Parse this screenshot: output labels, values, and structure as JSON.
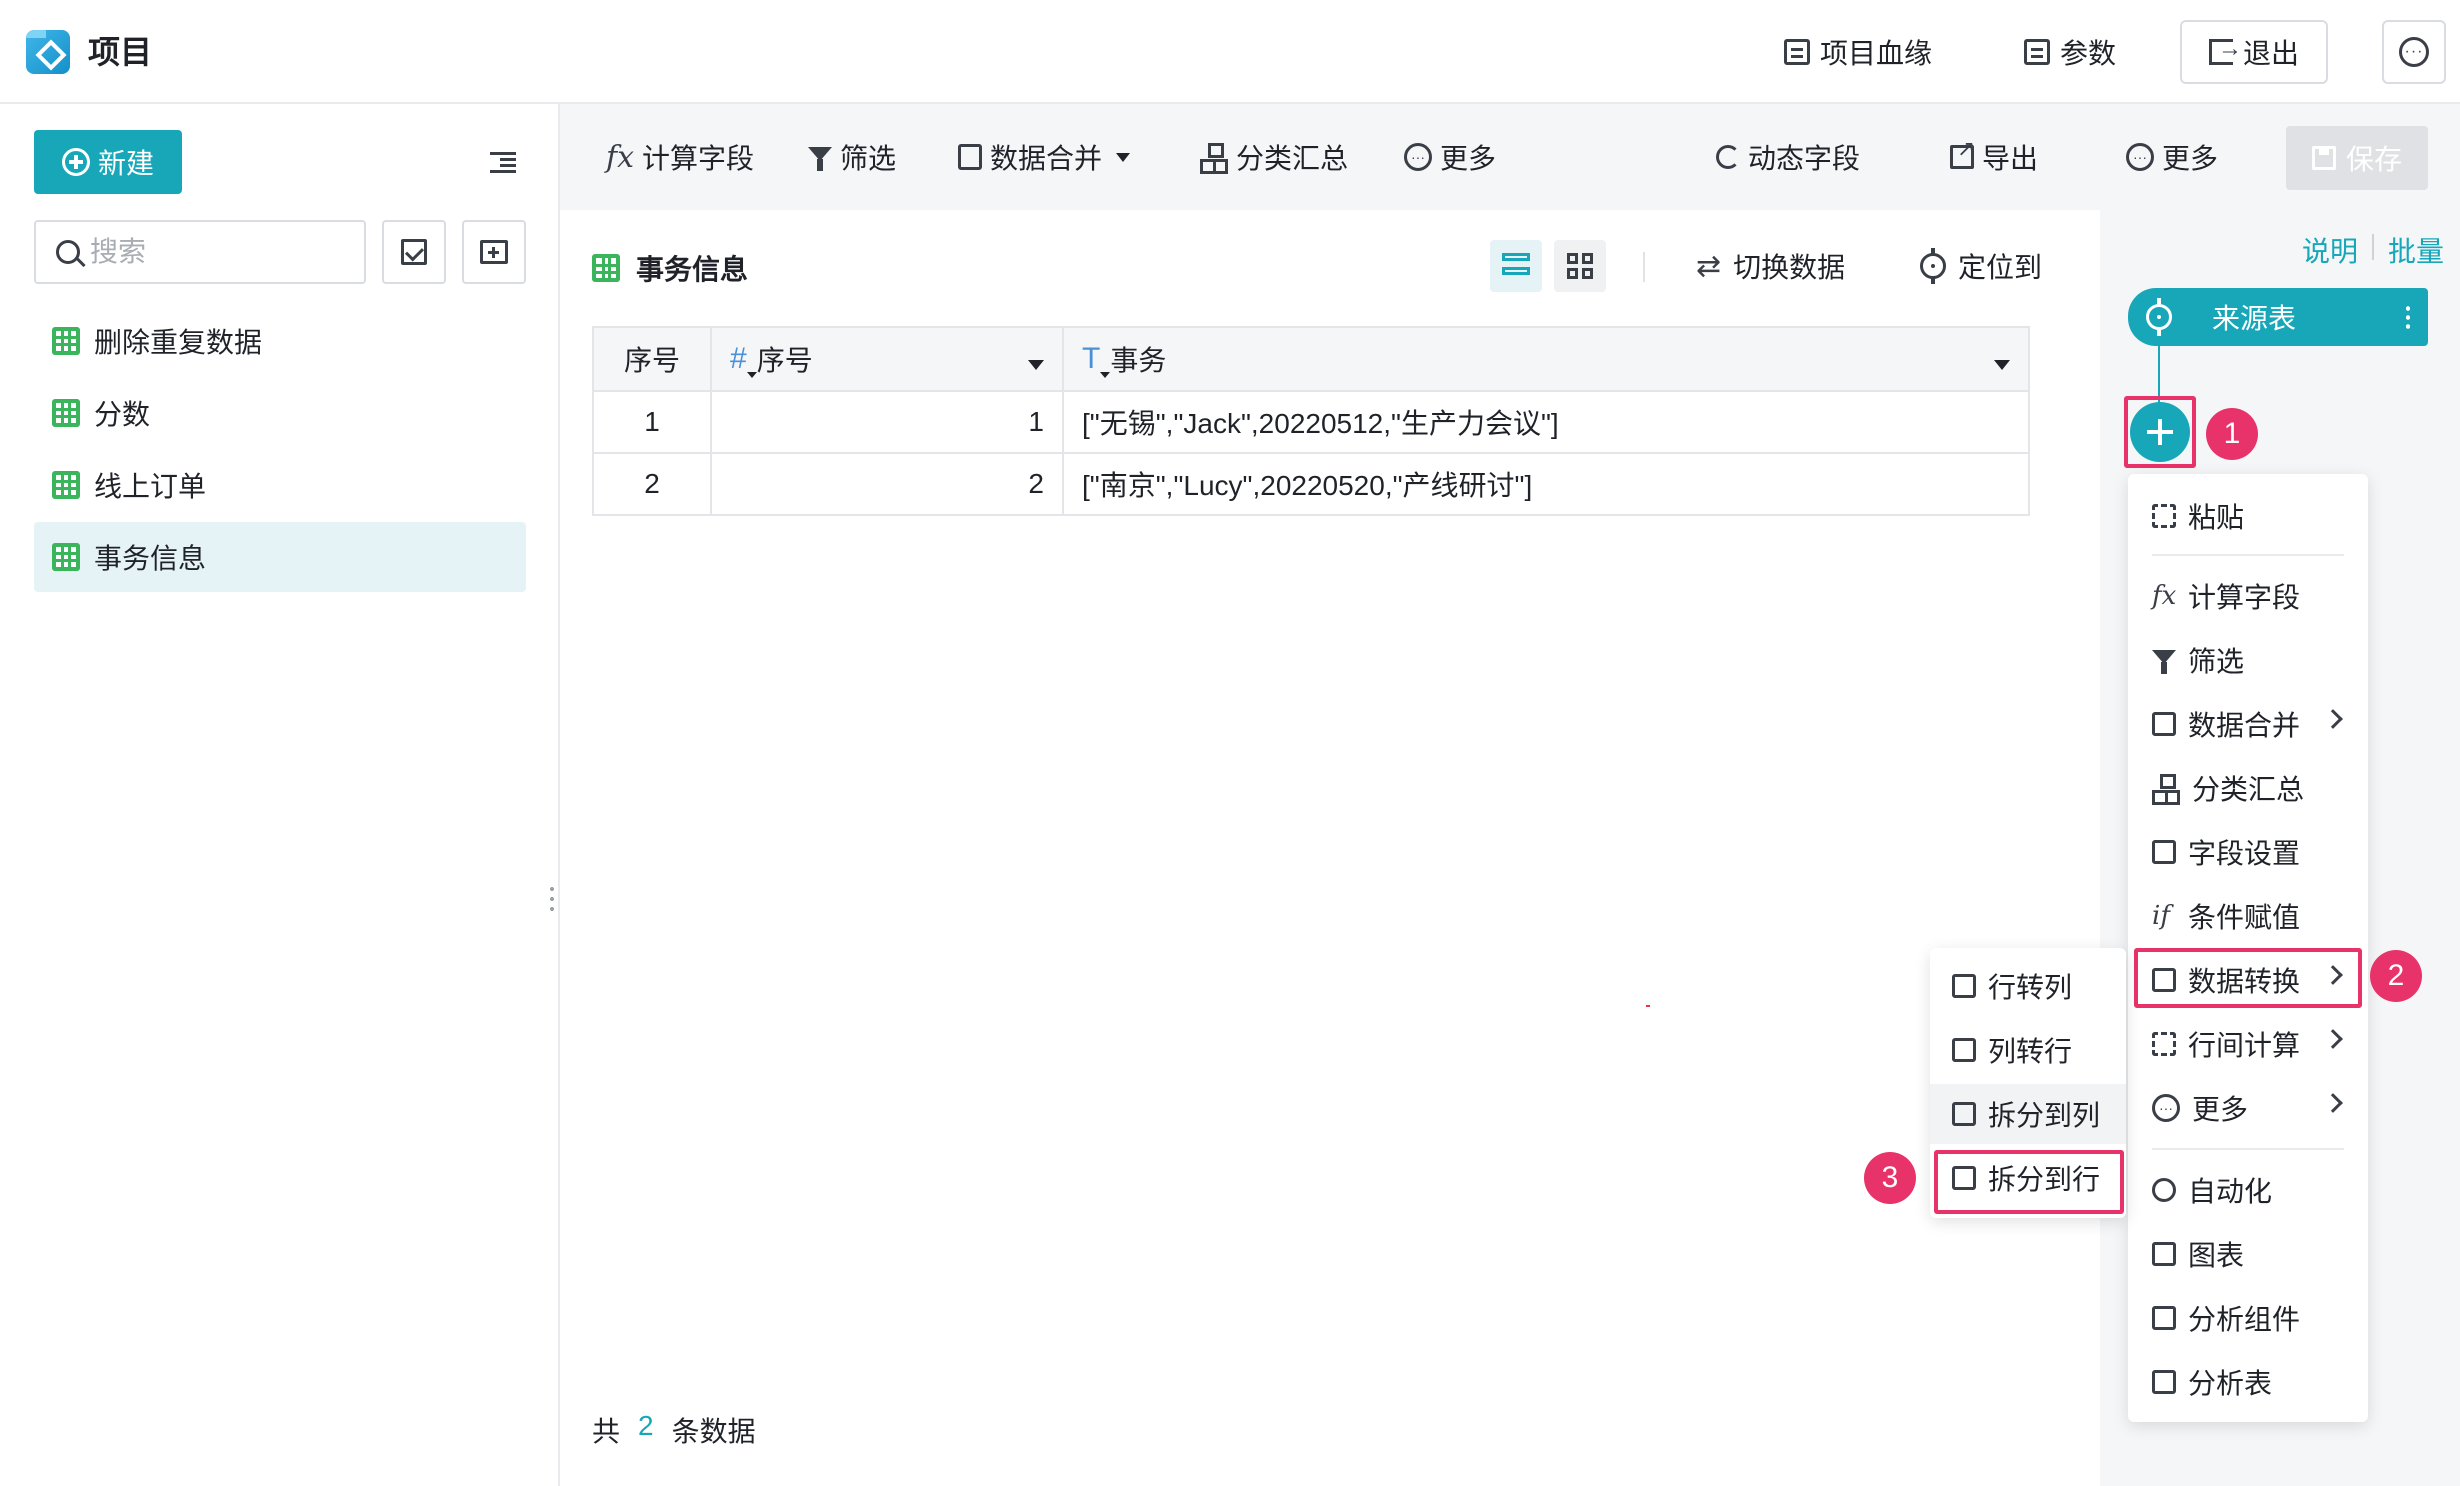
{
  "header": {
    "title": "项目",
    "lineage_label": "项目血缘",
    "params_label": "参数",
    "exit_label": "退出"
  },
  "sidebar": {
    "new_label": "新建",
    "search_placeholder": "搜索",
    "items": [
      {
        "label": "删除重复数据"
      },
      {
        "label": "分数"
      },
      {
        "label": "线上订单"
      },
      {
        "label": "事务信息"
      }
    ],
    "active_item": "事务信息"
  },
  "toolbar": {
    "calc_field": "计算字段",
    "filter": "筛选",
    "merge": "数据合并",
    "group_sum": "分类汇总",
    "more_left": "更多",
    "dynamic_field": "动态字段",
    "export": "导出",
    "more_right": "更多",
    "save": "保存"
  },
  "main": {
    "title": "事务信息",
    "switch_data": "切换数据",
    "locate": "定位到",
    "table": {
      "columns": [
        {
          "label": "序号",
          "type_icon": ""
        },
        {
          "label": "序号",
          "type_icon": "#"
        },
        {
          "label": "事务",
          "type_icon": "T"
        }
      ],
      "rows": [
        {
          "idx": "1",
          "num": "1",
          "text": "[\"无锡\",\"Jack\",20220512,\"生产力会议\"]"
        },
        {
          "idx": "2",
          "num": "2",
          "text": "[\"南京\",\"Lucy\",20220520,\"产线研讨\"]"
        }
      ]
    },
    "footer": {
      "prefix": "共",
      "count": "2",
      "suffix": "条数据"
    }
  },
  "flow": {
    "help_link": "说明",
    "batch_link": "批量",
    "source_node": "来源表"
  },
  "context_menu": {
    "items": [
      {
        "label": "粘贴",
        "icon": "paste-icon"
      },
      {
        "label": "计算字段",
        "icon": "fx-icon"
      },
      {
        "label": "筛选",
        "icon": "filter-icon"
      },
      {
        "label": "数据合并",
        "icon": "merge-icon",
        "submenu": true
      },
      {
        "label": "分类汇总",
        "icon": "group-icon"
      },
      {
        "label": "字段设置",
        "icon": "field-settings-icon"
      },
      {
        "label": "条件赋值",
        "icon": "if-icon"
      },
      {
        "label": "数据转换",
        "icon": "transform-icon",
        "submenu": true
      },
      {
        "label": "行间计算",
        "icon": "row-calc-icon",
        "submenu": true
      },
      {
        "label": "更多",
        "icon": "more-icon",
        "submenu": true
      },
      {
        "label": "自动化",
        "icon": "automation-icon"
      },
      {
        "label": "图表",
        "icon": "chart-icon"
      },
      {
        "label": "分析组件",
        "icon": "analysis-component-icon"
      },
      {
        "label": "分析表",
        "icon": "analysis-table-icon"
      }
    ]
  },
  "submenu": {
    "items": [
      {
        "label": "行转列"
      },
      {
        "label": "列转行"
      },
      {
        "label": "拆分到列"
      },
      {
        "label": "拆分到行"
      }
    ]
  },
  "badges": [
    "1",
    "2",
    "3"
  ],
  "colors": {
    "accent": "#17a7b8",
    "highlight": "#e8336a",
    "table_icon": "#3bb55b"
  }
}
